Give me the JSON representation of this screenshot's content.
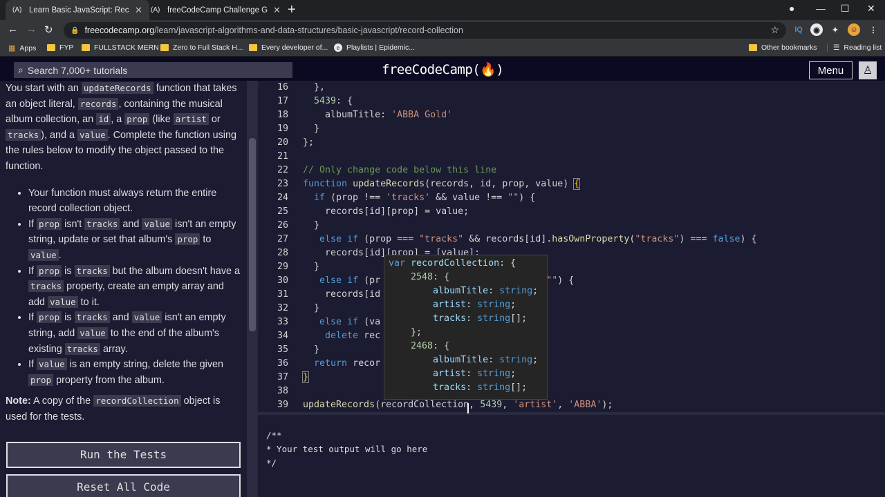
{
  "browser": {
    "tabs": [
      {
        "favicon": "(A)",
        "title": "Learn Basic JavaScript: Record Co"
      },
      {
        "favicon": "(A)",
        "title": "freeCodeCamp Challenge Guide:"
      }
    ],
    "url_domain": "freecodecamp.org",
    "url_path": "/learn/javascript-algorithms-and-data-structures/basic-javascript/record-collection",
    "bookmarks": [
      "Apps",
      "FYP",
      "FULLSTACK MERN",
      "Zero to Full Stack H...",
      "Every developer of...",
      "Playlists | Epidemic..."
    ],
    "other_bookmarks": "Other bookmarks",
    "reading_list": "Reading list"
  },
  "nav": {
    "search_placeholder": "Search 7,000+ tutorials",
    "logo": "freeCodeCamp(🔥)",
    "menu_label": "Menu"
  },
  "instructions": {
    "intro": [
      "You start with an ",
      "updateRecords",
      " function that takes an object literal, ",
      "records",
      ", containing the musical album collection, an ",
      "id",
      ", a ",
      "prop",
      " (like ",
      "artist",
      " or ",
      "tracks",
      "), and a ",
      "value",
      ". Complete the function using the rules below to modify the object passed to the function."
    ],
    "rule1": "Your function must always return the entire record collection object.",
    "rule2": [
      "If ",
      "prop",
      " isn't ",
      "tracks",
      " and ",
      "value",
      " isn't an empty string, update or set that album's ",
      "prop",
      " to ",
      "value",
      "."
    ],
    "rule3": [
      "If ",
      "prop",
      " is ",
      "tracks",
      " but the album doesn't have a ",
      "tracks",
      " property, create an empty array and add ",
      "value",
      " to it."
    ],
    "rule4": [
      "If ",
      "prop",
      " is ",
      "tracks",
      " and ",
      "value",
      " isn't an empty string, add ",
      "value",
      " to the end of the album's existing ",
      "tracks",
      " array."
    ],
    "rule5": [
      "If ",
      "value",
      " is an empty string, delete the given ",
      "prop",
      " property from the album."
    ],
    "note": [
      "Note:",
      " A copy of the ",
      "recordCollection",
      " object is used for the tests."
    ],
    "run_button": "Run the Tests",
    "reset_button": "Reset All Code"
  },
  "editor": {
    "line_numbers": [
      "16",
      "17",
      "18",
      "19",
      "20",
      "21",
      "22",
      "23",
      "24",
      "25",
      "26",
      "27",
      "28",
      "29",
      "30",
      "31",
      "32",
      "33",
      "34",
      "35",
      "36",
      "37",
      "38",
      "39"
    ]
  },
  "tooltip": {
    "lines": [
      "var recordCollection: {",
      "    2548: {",
      "        albumTitle: string;",
      "        artist: string;",
      "        tracks: string[];",
      "    };",
      "    2468: {",
      "        albumTitle: string;",
      "        artist: string;",
      "        tracks: string[];"
    ]
  },
  "output": {
    "text": "/**\n* Your test output will go here\n*/"
  }
}
